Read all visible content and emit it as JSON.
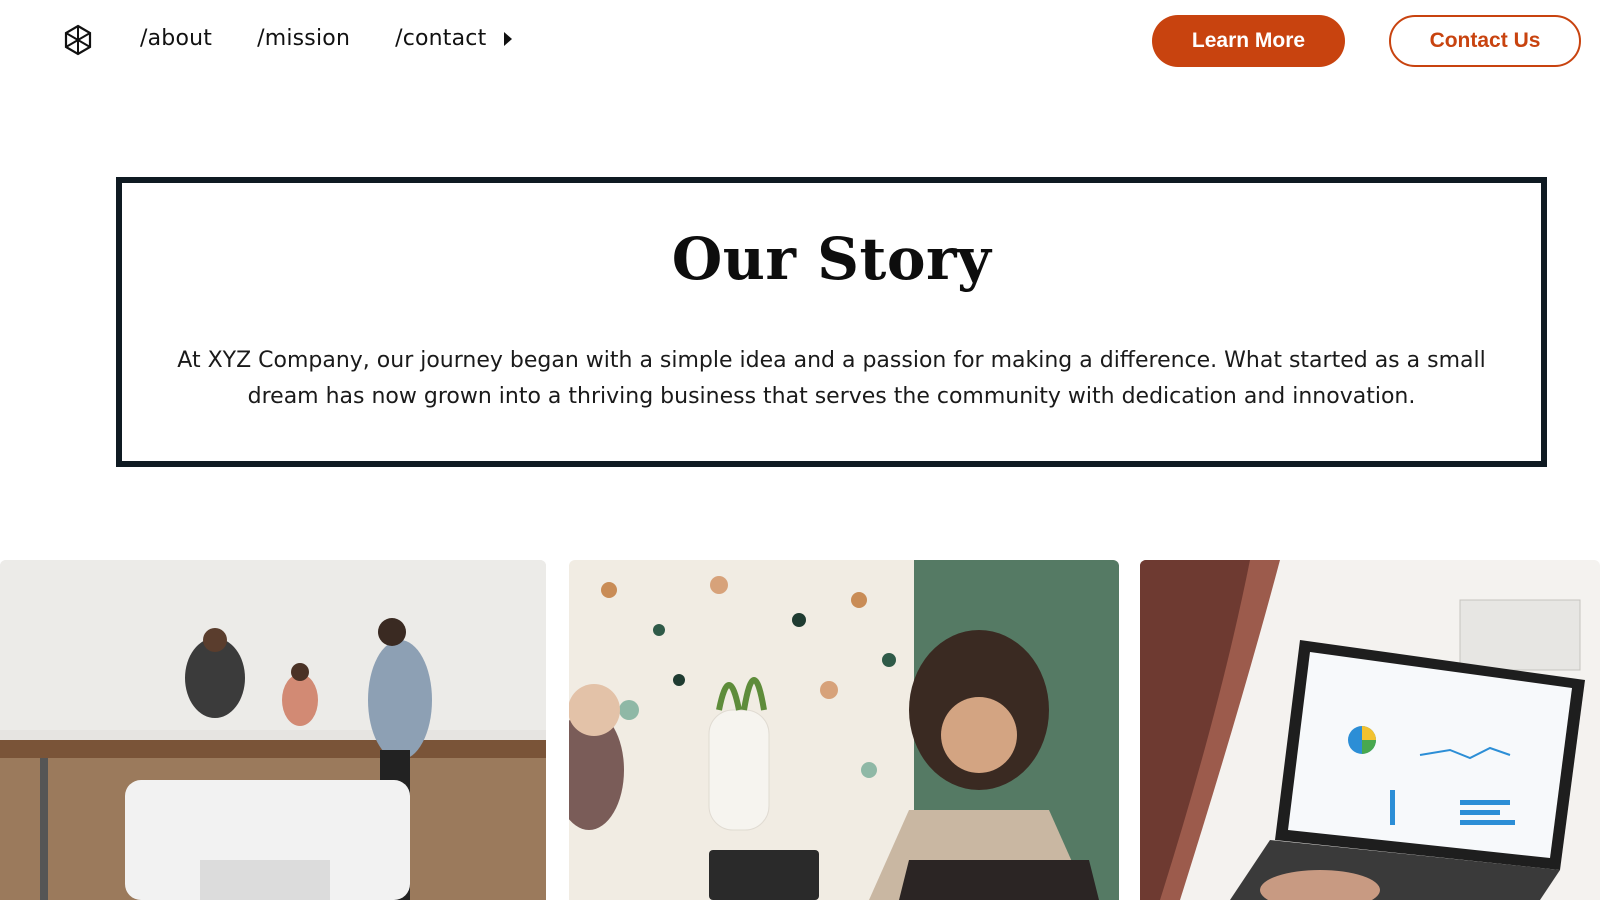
{
  "nav": {
    "links": [
      "/about",
      "/mission",
      "/contact"
    ],
    "learn_more": "Learn More",
    "contact_us": "Contact Us"
  },
  "story": {
    "title": "Our Story",
    "text": "At XYZ Company, our journey began with a simple idea and a passion for making a difference. What started as a small dream has now grown into a thriving business that serves the community with dedication and innovation."
  },
  "colors": {
    "accent": "#c8430f",
    "border": "#0f1a22"
  },
  "icons": {
    "logo": "hexagon-asterisk-icon",
    "dropdown": "caret-right-icon"
  }
}
